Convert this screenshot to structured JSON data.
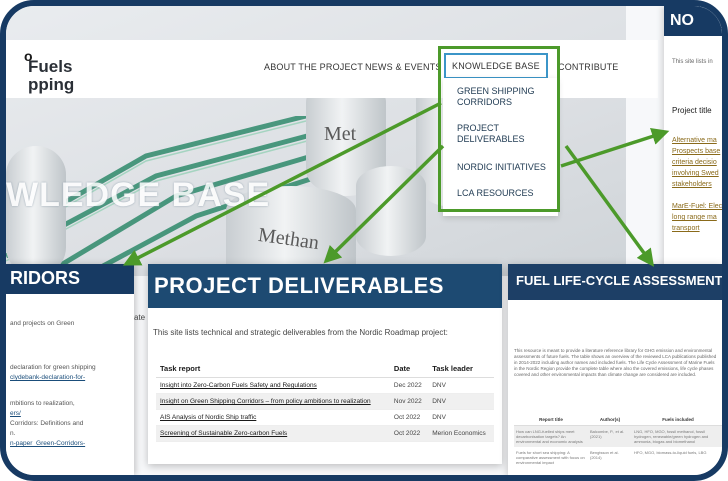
{
  "logo": {
    "top": "o",
    "main_line1": "Fuels",
    "main_line2": "pping"
  },
  "nav": {
    "items": [
      {
        "label": "ABOUT THE PROJECT"
      },
      {
        "label": "NEWS & EVENTS"
      },
      {
        "label": "KNOWLEDGE BASE"
      },
      {
        "label": "CONTRIBUTE"
      }
    ],
    "dropdown": [
      {
        "label": "GREEN SHIPPING CORRIDORS"
      },
      {
        "label": "PROJECT DELIVERABLES"
      },
      {
        "label": "NORDIC INITIATIVES"
      },
      {
        "label": "LCA RESOURCES"
      }
    ]
  },
  "hero": {
    "title": "WLEDGE BASE",
    "tank_label_1": "Met",
    "tank_label_2": "Methan"
  },
  "right_panel": {
    "title": "NO",
    "text": "This site lists in",
    "heading": "Project title",
    "links": [
      "Alternative ma",
      "Prospects base",
      "criteria decisio",
      "involving Swed",
      "stakeholders",
      "MarE-Fuel: Elec",
      "long range ma",
      "transport"
    ]
  },
  "left_card": {
    "title": "RIDORS",
    "text_line1": "and projects on Green",
    "text_line2": "ate",
    "text_line3": "declaration for green shipping",
    "link1": "clydebank-declaration-for-",
    "text_line4": "mbitions to realization,",
    "link2": "ers/",
    "text_line5": "Corridors: Definitions and",
    "text_line6": "n.",
    "link3": "n-paper_Green-Corridors-"
  },
  "deliverables": {
    "title": "PROJECT DELIVERABLES",
    "intro": "This site lists technical and strategic deliverables from the Nordic Roadmap project:",
    "headers": {
      "report": "Task report",
      "date": "Date",
      "leader": "Task leader"
    },
    "rows": [
      {
        "report": "Insight into Zero-Carbon Fuels Safety and Regulations",
        "date": "Dec 2022",
        "leader": "DNV"
      },
      {
        "report": "Insight on Green Shipping Corridors – from policy ambitions to realization",
        "date": "Nov 2022",
        "leader": "DNV"
      },
      {
        "report": "AIS Analysis of Nordic Ship traffic",
        "date": "Oct 2022",
        "leader": "DNV"
      },
      {
        "report": "Screening of Sustainable Zero-carbon Fuels",
        "date": "Oct 2022",
        "leader": "Merion Economics"
      }
    ]
  },
  "lca": {
    "title": "FUEL LIFE-CYCLE ASSESSMENT",
    "text": "This resource is meant to provide a literature reference library for GHG emission and environmental assessments of future fuels. The table shows an overview of the reviewed LCA publications published in 2014-2022 including author names and included fuels. The Life Cycle Assessment of Marine Fuels in the Nordic Region provide the complete table where also the covered emissions, life cycle phases covered and other environmental impacts than climate change are considered are included.",
    "headers": {
      "title": "Report title",
      "authors": "Author(s)",
      "fuels": "Fuels included"
    },
    "rows": [
      {
        "title": "How can LNG-fuelled ships meet decarbonisation targets? An environmental and economic analysis",
        "authors": "Balcombe, P., et al. (2021)",
        "fuels": "LNG, HFO, MGO, fossil methanol, fossil hydrogen, renewable/green hydrogen and ammonia, biogas and biomethanol"
      },
      {
        "title": "Fuels for short sea shipping: A comparative assessment with focus on environmental impact",
        "authors": "Bengtsson et al. (2014)",
        "fuels": "HFO, MGO, biomass-to-liquid fuels, LBG"
      }
    ]
  },
  "colors": {
    "navy": "#173a63",
    "highlight_green": "#4c9a2a",
    "nav_active_border": "#3b95c8"
  }
}
